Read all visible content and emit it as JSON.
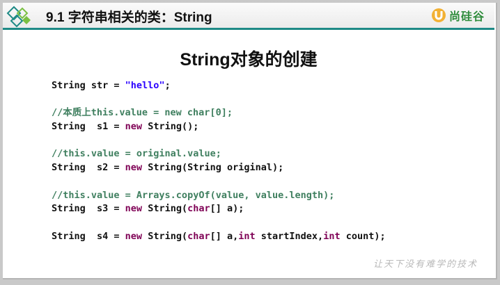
{
  "header": {
    "section_title": "9.1 字符串相关的类：String",
    "brand_name": "尚硅谷",
    "accent_color": "#1e8a86",
    "brand_color": "#2f8c3c"
  },
  "slide": {
    "heading": "String对象的创建",
    "watermark": "让天下没有难学的技术"
  },
  "code_lines": [
    [
      {
        "t": "String str = ",
        "c": ""
      },
      {
        "t": "\"hello\"",
        "c": "str"
      },
      {
        "t": ";",
        "c": ""
      }
    ],
    [],
    [
      {
        "t": "//本质上this.value = new char[0];",
        "c": "cm"
      }
    ],
    [
      {
        "t": "String  s1 = ",
        "c": ""
      },
      {
        "t": "new",
        "c": "kw"
      },
      {
        "t": " String();",
        "c": ""
      }
    ],
    [],
    [
      {
        "t": "//this.value = original.value;",
        "c": "cm"
      }
    ],
    [
      {
        "t": "String  s2 = ",
        "c": ""
      },
      {
        "t": "new",
        "c": "kw"
      },
      {
        "t": " String(String original);",
        "c": ""
      }
    ],
    [],
    [
      {
        "t": "//this.value = Arrays.copyOf(value, value.length);",
        "c": "cm"
      }
    ],
    [
      {
        "t": "String  s3 = ",
        "c": ""
      },
      {
        "t": "new",
        "c": "kw"
      },
      {
        "t": " String(",
        "c": ""
      },
      {
        "t": "char",
        "c": "kw"
      },
      {
        "t": "[] a);",
        "c": ""
      }
    ],
    [],
    [
      {
        "t": "String  s4 = ",
        "c": ""
      },
      {
        "t": "new",
        "c": "kw"
      },
      {
        "t": " String(",
        "c": ""
      },
      {
        "t": "char",
        "c": "kw"
      },
      {
        "t": "[] a,",
        "c": ""
      },
      {
        "t": "int",
        "c": "kw"
      },
      {
        "t": " startIndex,",
        "c": ""
      },
      {
        "t": "int",
        "c": "kw"
      },
      {
        "t": " count);",
        "c": ""
      }
    ]
  ]
}
